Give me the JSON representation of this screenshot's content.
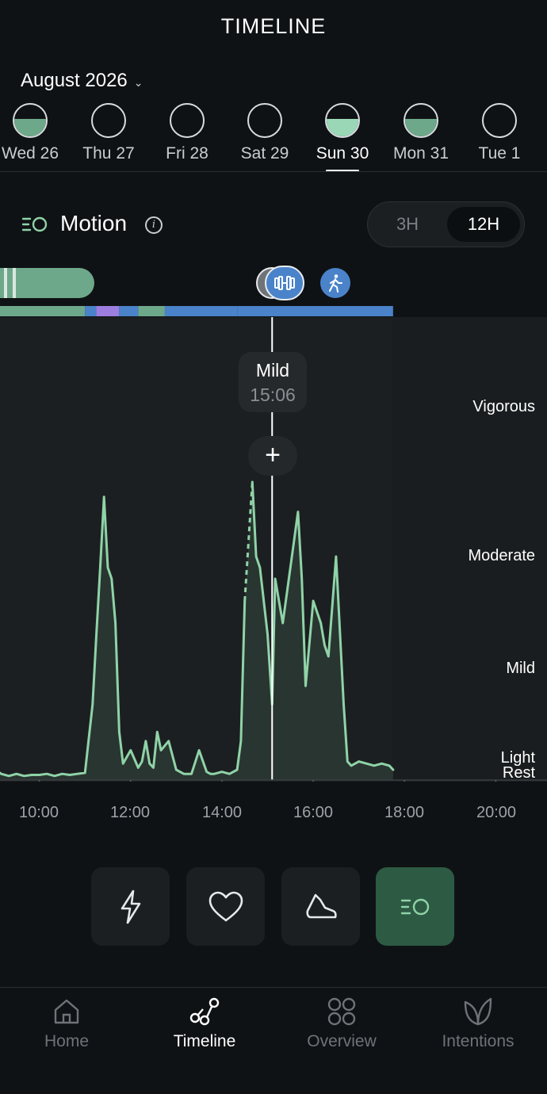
{
  "header": {
    "title": "TIMELINE",
    "month": "August 2026"
  },
  "days": [
    {
      "label": "Wed 26",
      "fill": 0.55,
      "color": "#6ea88a",
      "active": false
    },
    {
      "label": "Thu 27",
      "fill": 0,
      "color": "#6ea88a",
      "active": false
    },
    {
      "label": "Fri 28",
      "fill": 0,
      "color": "#6ea88a",
      "active": false
    },
    {
      "label": "Sat 29",
      "fill": 0,
      "color": "#6ea88a",
      "active": false
    },
    {
      "label": "Sun 30",
      "fill": 0.55,
      "color": "#9ad7b7",
      "active": true
    },
    {
      "label": "Mon 31",
      "fill": 0.55,
      "color": "#6ea88a",
      "active": false
    },
    {
      "label": "Tue 1",
      "fill": 0,
      "color": "#6ea88a",
      "active": false
    }
  ],
  "section": {
    "label": "Motion",
    "toggle_3h": "3H",
    "toggle_12h": "12H",
    "selected_range": "12H"
  },
  "tooltip": {
    "level": "Mild",
    "time": "15:06"
  },
  "levels": {
    "vigorous": "Vigorous",
    "moderate": "Moderate",
    "mild": "Mild",
    "light": "Light",
    "rest": "Rest"
  },
  "x_ticks": [
    "10:00",
    "12:00",
    "14:00",
    "16:00",
    "18:00",
    "20:00"
  ],
  "colors": {
    "accent": "#8fd3a7",
    "chart_bg": "#1c1f21",
    "blue": "#4a83c9",
    "purple": "#9d7de0",
    "active_button": "#2c5a43"
  },
  "activity_icons": [
    "dumbbell-icon",
    "walking-icon"
  ],
  "metric_buttons": [
    "lightning-icon",
    "heart-icon",
    "shoe-icon",
    "motion-icon"
  ],
  "nav": [
    {
      "label": "Home",
      "icon": "home-icon",
      "active": false
    },
    {
      "label": "Timeline",
      "icon": "timeline-icon",
      "active": true
    },
    {
      "label": "Overview",
      "icon": "overview-icon",
      "active": false
    },
    {
      "label": "Intentions",
      "icon": "leaf-icon",
      "active": false
    }
  ],
  "chart_data": {
    "type": "area",
    "ylabels": [
      "Rest",
      "Light",
      "Mild",
      "Moderate",
      "Vigorous"
    ],
    "x_range": [
      "09:00",
      "21:00"
    ],
    "cursor_time": "15:06",
    "series": [
      {
        "x": [
          "09:00",
          "09:10",
          "09:20",
          "09:30",
          "09:40",
          "09:50",
          "10:00",
          "10:10",
          "10:20",
          "10:30",
          "10:40",
          "10:50",
          "11:00",
          "11:10",
          "11:15",
          "11:20",
          "11:25",
          "11:30",
          "11:35",
          "11:40",
          "11:45",
          "11:50",
          "12:00",
          "12:10",
          "12:15",
          "12:20",
          "12:25",
          "12:30",
          "12:35",
          "12:40",
          "12:50",
          "13:00",
          "13:10",
          "13:20",
          "13:30",
          "13:40",
          "13:45",
          "13:50",
          "14:00",
          "14:10",
          "14:20",
          "14:25",
          "14:30",
          "14:40",
          "14:45",
          "14:50",
          "15:00",
          "15:06",
          "15:10",
          "15:20",
          "15:30",
          "15:40",
          "15:45",
          "15:50",
          "16:00",
          "16:10",
          "16:15",
          "16:20",
          "16:30",
          "16:40",
          "16:45",
          "16:50",
          "17:00",
          "17:10",
          "17:20",
          "17:30",
          "17:40",
          "17:45"
        ],
        "y": [
          0.55,
          0.3,
          0.2,
          0.3,
          0.2,
          0.25,
          0.25,
          0.3,
          0.2,
          0.3,
          0.25,
          0.3,
          0.35,
          1.6,
          2.3,
          2.9,
          3.4,
          2.9,
          2.8,
          2.4,
          1.3,
          0.8,
          1.1,
          0.6,
          0.9,
          1.2,
          0.8,
          0.6,
          1.3,
          1.1,
          1.2,
          0.5,
          0.3,
          0.3,
          1.1,
          0.4,
          0.3,
          0.3,
          0.4,
          0.3,
          0.5,
          1.2,
          2.6,
          3.5,
          3.0,
          2.9,
          2.3,
          1.6,
          2.8,
          2.4,
          2.9,
          3.3,
          2.8,
          1.8,
          2.6,
          2.4,
          2.2,
          2.1,
          3.0,
          1.6,
          0.9,
          0.7,
          0.9,
          0.8,
          0.7,
          0.8,
          0.7,
          0.5
        ]
      }
    ]
  }
}
